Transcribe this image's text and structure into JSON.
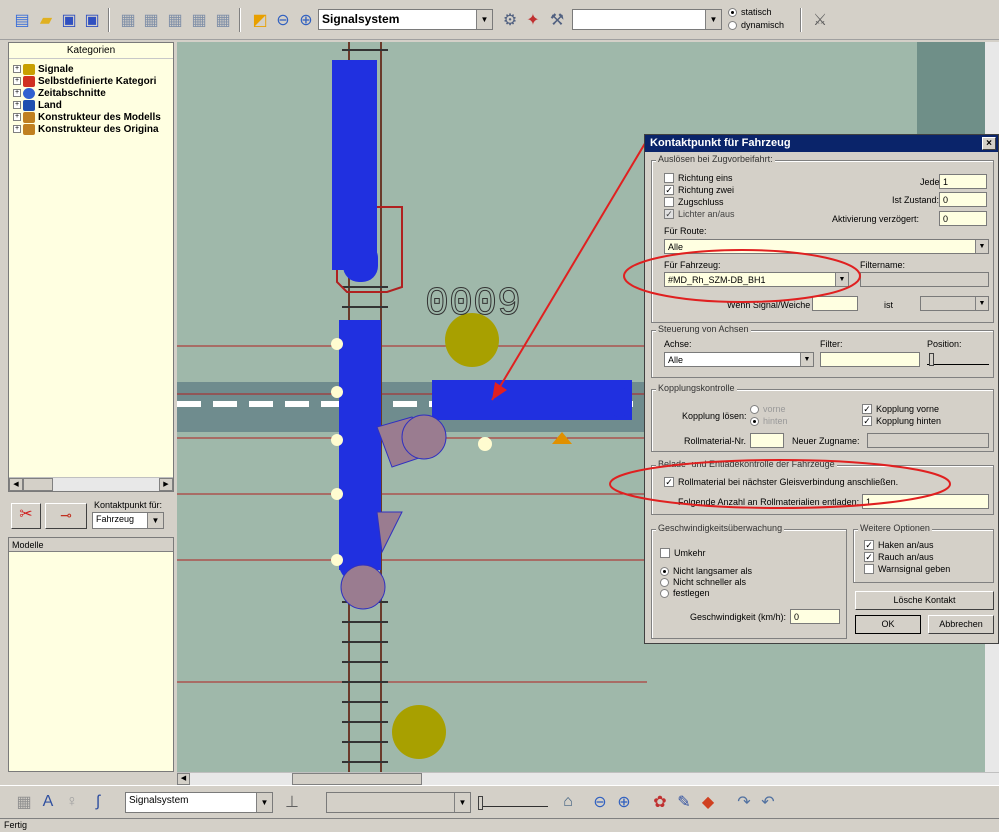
{
  "toolbar": {
    "combo_signalsystem": "Signalsystem",
    "combo_empty": "",
    "radio_static": "statisch",
    "radio_dynamic": "dynamisch"
  },
  "categories": {
    "header": "Kategorien",
    "items": [
      {
        "label": "Signale",
        "color": "#c8a000"
      },
      {
        "label": "Selbstdefinierte Kategori",
        "color": "#d03020"
      },
      {
        "label": "Zeitabschnitte",
        "color": "#3060d0"
      },
      {
        "label": "Land",
        "color": "#2050b0"
      },
      {
        "label": "Konstrukteur des Modells",
        "color": "#c08020"
      },
      {
        "label": "Konstrukteur des Origina",
        "color": "#c08020"
      }
    ]
  },
  "tool_panel": {
    "label": "Kontaktpunkt für:",
    "select_value": "Fahrzeug"
  },
  "models": {
    "header": "Modelle"
  },
  "canvas": {
    "counter": "0009"
  },
  "dialog": {
    "title": "Kontaktpunkt für Fahrzeug",
    "close": "×",
    "trigger": {
      "title": "Auslösen bei Zugvorbeifahrt:",
      "direction_one": "Richtung eins",
      "direction_two": "Richtung zwei",
      "train_end": "Zugschluss",
      "lights": "Lichter an/aus",
      "every_label": "Jeder:",
      "every_value": "1",
      "state_label": "Ist Zustand:",
      "state_value": "0",
      "delay_label": "Aktivierung verzögert:",
      "delay_value": "0",
      "route_label": "Für Route:",
      "route_value": "Alle",
      "vehicle_label": "Für Fahrzeug:",
      "vehicle_value": "#MD_Rh_SZM-DB_BH1",
      "filter_label": "Filtername:",
      "signal_label": "Wenn Signal/Weiche #",
      "ist_label": "ist"
    },
    "axles": {
      "title": "Steuerung von Achsen",
      "axle_label": "Achse:",
      "axle_value": "Alle",
      "filter_label": "Filter:",
      "position_label": "Position:"
    },
    "coupling": {
      "title": "Kopplungskontrolle",
      "release_label": "Kopplung lösen:",
      "front_radio": "vorne",
      "rear_radio": "hinten",
      "couple_front": "Kopplung vorne",
      "couple_rear": "Kopplung hinten",
      "rolling_nr_label": "Rollmaterial-Nr.",
      "new_train_label": "Neuer Zugname:"
    },
    "loading": {
      "title": "Belade- und Entladekontrolle der Fahrzeuge",
      "attach_label": "Rollmaterial bei nächster Gleisverbindung anschließen.",
      "unload_label": "Folgende Anzahl an Rollmaterialien entladen:",
      "unload_value": "1"
    },
    "speed": {
      "title": "Geschwindigkeitsüberwachung",
      "reverse": "Umkehr",
      "not_slower": "Nicht langsamer als",
      "not_faster": "Nicht schneller als",
      "set": "festlegen",
      "speed_label": "Geschwindigkeit (km/h):",
      "speed_value": "0"
    },
    "options": {
      "title": "Weitere Optionen",
      "hook": "Haken an/aus",
      "smoke": "Rauch an/aus",
      "warn": "Warnsignal geben",
      "delete_button": "Lösche Kontakt",
      "ok_button": "OK",
      "cancel_button": "Abbrechen"
    }
  },
  "bottom": {
    "combo_value": "Signalsystem",
    "combo2_value": ""
  },
  "status": {
    "text": "Fertig"
  }
}
